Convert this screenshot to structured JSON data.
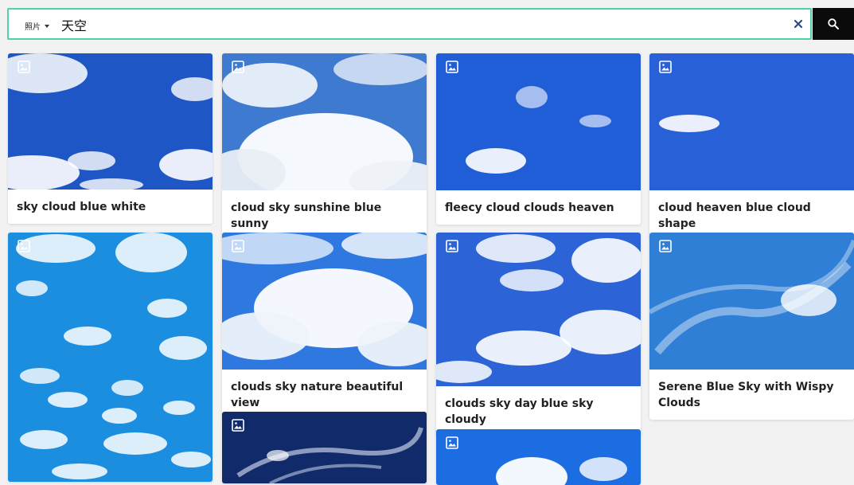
{
  "search": {
    "type_label": "照片",
    "query": "天空"
  },
  "results": [
    {
      "caption": "sky cloud blue white"
    },
    {
      "caption": "cloud sky sunshine blue sunny"
    },
    {
      "caption": "fleecy cloud clouds heaven"
    },
    {
      "caption": "cloud heaven blue cloud shape"
    },
    {
      "caption": ""
    },
    {
      "caption": "clouds sky nature beautiful view"
    },
    {
      "caption": "clouds sky day blue sky cloudy"
    },
    {
      "caption": "Serene Blue Sky with Wispy Clouds"
    },
    {
      "caption": ""
    },
    {
      "caption": ""
    }
  ],
  "icons": {
    "type_dropdown": "chevron-down-icon",
    "clear": "close-icon",
    "search": "search-icon",
    "result_type": "image-icon"
  },
  "colors": {
    "search_border": "#4fd3a6",
    "search_button": "#0b0b0b",
    "clear_icon": "#2b4a86"
  }
}
